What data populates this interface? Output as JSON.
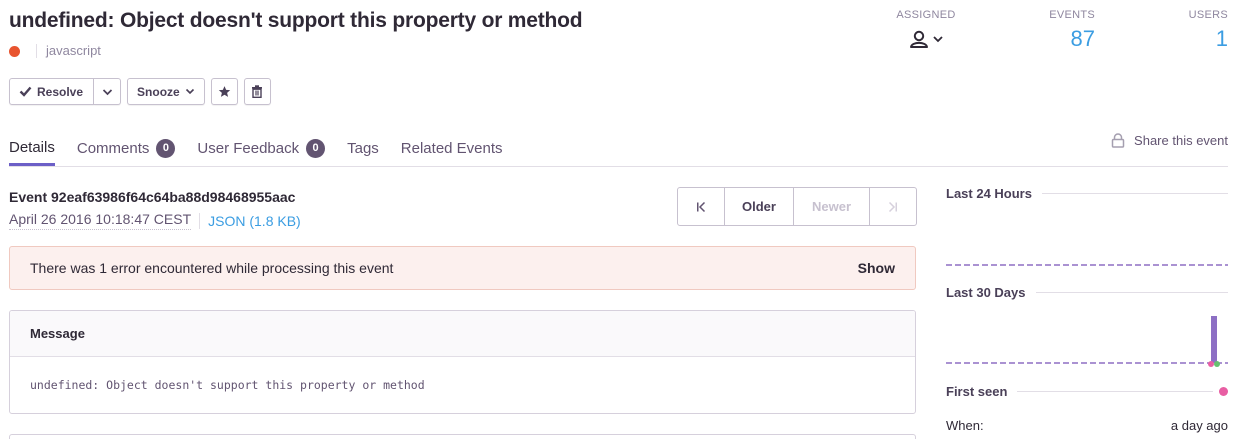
{
  "issue": {
    "title": "undefined: Object doesn't support this property or method",
    "platform": "javascript",
    "level_color": "#e8542f"
  },
  "stats": {
    "assigned_label": "ASSIGNED",
    "events_label": "EVENTS",
    "events_value": "87",
    "users_label": "USERS",
    "users_value": "1"
  },
  "toolbar": {
    "resolve_label": "Resolve",
    "snooze_label": "Snooze",
    "icons": [
      "check-icon",
      "chevron-down-icon",
      "star-icon",
      "trash-icon"
    ]
  },
  "tabs": [
    {
      "label": "Details",
      "active": true
    },
    {
      "label": "Comments",
      "count": "0"
    },
    {
      "label": "User Feedback",
      "count": "0"
    },
    {
      "label": "Tags"
    },
    {
      "label": "Related Events"
    }
  ],
  "share_label": "Share this event",
  "event": {
    "id_label": "Event 92eaf63986f64c64ba88d98468955aac",
    "date": "April 26 2016 10:18:47 CEST",
    "json_link": "JSON (1.8 KB)"
  },
  "pager": {
    "older": "Older",
    "newer": "Newer"
  },
  "alert": {
    "text": "There was 1 error encountered while processing this event",
    "action": "Show"
  },
  "message": {
    "heading": "Message",
    "body": "undefined: Object doesn't support this property or method"
  },
  "sidebar": {
    "last24": "Last 24 Hours",
    "last30": "Last 30 Days",
    "first_seen": "First seen",
    "when_label": "When:",
    "when_value": "a day ago"
  },
  "colors": {
    "accent": "#6c5fc7",
    "link": "#3b9de2",
    "first_seen_dot": "#e85ea3",
    "last_seen_dot": "#66c06f",
    "bar": "#8d6fc4"
  }
}
